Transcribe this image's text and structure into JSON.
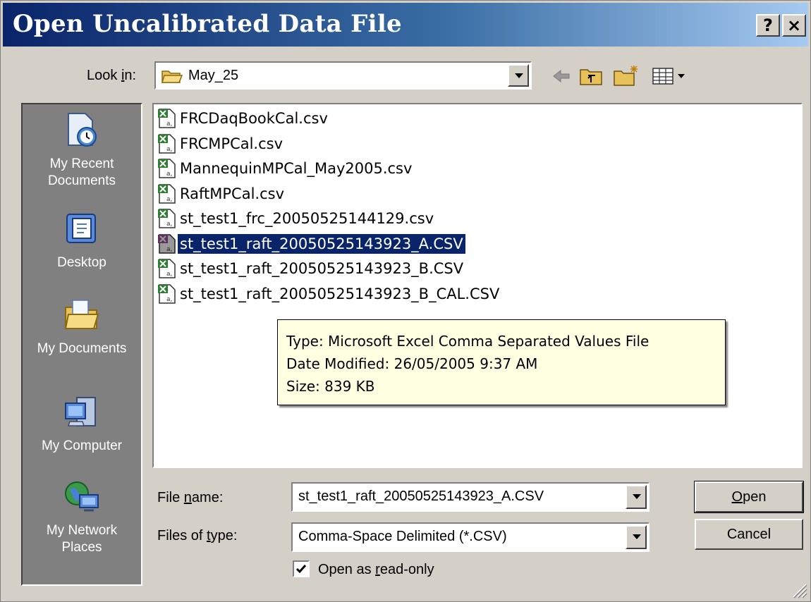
{
  "title": "Open Uncalibrated Data File",
  "title_buttons": {
    "help": "?",
    "close": "×"
  },
  "look_in": {
    "label_prefix": "Look ",
    "label_underlined": "i",
    "label_suffix": "n:",
    "value": "May_25"
  },
  "toolbar": {
    "icons": [
      "back-arrow-icon",
      "up-one-level-icon",
      "create-new-folder-icon",
      "view-menu-icon"
    ]
  },
  "places": [
    {
      "label": "My Recent\nDocuments",
      "icon": "recent-documents-icon"
    },
    {
      "label": "Desktop",
      "icon": "desktop-icon"
    },
    {
      "label": "My Documents",
      "icon": "my-documents-icon"
    },
    {
      "label": "My Computer",
      "icon": "my-computer-icon"
    },
    {
      "label": "My Network\nPlaces",
      "icon": "network-places-icon"
    }
  ],
  "files": [
    {
      "name": "FRCDaqBookCal.csv",
      "selected": false
    },
    {
      "name": "FRCMPCal.csv",
      "selected": false
    },
    {
      "name": "MannequinMPCal_May2005.csv",
      "selected": false
    },
    {
      "name": "RaftMPCal.csv",
      "selected": false
    },
    {
      "name": "st_test1_frc_20050525144129.csv",
      "selected": false
    },
    {
      "name": "st_test1_raft_20050525143923_A.CSV",
      "selected": true
    },
    {
      "name": "st_test1_raft_20050525143923_B.CSV",
      "selected": false
    },
    {
      "name": "st_test1_raft_20050525143923_B_CAL.CSV",
      "selected": false
    }
  ],
  "tooltip": {
    "type": "Type: Microsoft Excel Comma Separated Values File",
    "date": "Date Modified: 26/05/2005 9:37 AM",
    "size": "Size: 839 KB"
  },
  "file_name": {
    "label_prefix": "File ",
    "label_underlined": "n",
    "label_suffix": "ame:",
    "value": "st_test1_raft_20050525143923_A.CSV"
  },
  "file_type": {
    "label_prefix": "Files of ",
    "label_underlined": "t",
    "label_suffix": "ype:",
    "value": "Comma-Space Delimited (*.CSV)"
  },
  "readonly": {
    "prefix": "Open as ",
    "underlined": "r",
    "suffix": "ead-only",
    "checked": true
  },
  "buttons": {
    "open_underlined": "O",
    "open_rest": "pen",
    "cancel": "Cancel"
  },
  "colors": {
    "title_start": "#0a246a",
    "title_end": "#a6caf0",
    "selection": "#0a246a",
    "tooltip_bg": "#ffffe1",
    "face": "#d4d0c8"
  }
}
